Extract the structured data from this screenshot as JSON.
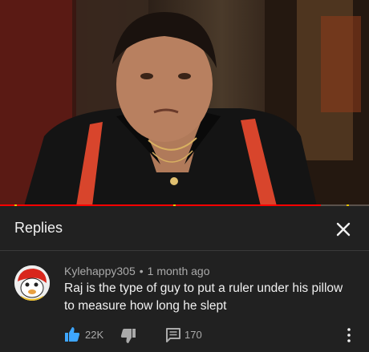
{
  "video": {
    "progress_fraction": 0.87,
    "chapter_marks_fraction": [
      0.04,
      0.47,
      0.94
    ]
  },
  "panel": {
    "title": "Replies",
    "close_icon": "close-icon"
  },
  "comment": {
    "author": "Kylehappy305",
    "separator": "•",
    "timestamp": "1 month ago",
    "text": "Raj is the type of guy to put a ruler under his pillow to measure how long he slept",
    "like_count": "22K",
    "reply_count": "170",
    "icons": {
      "avatar": "avatar",
      "like": "thumbs-up-icon",
      "dislike": "thumbs-down-icon",
      "reply": "comment-icon",
      "more": "more-vert-icon"
    }
  },
  "colors": {
    "background": "#212121",
    "text_primary": "#f1f1f1",
    "text_secondary": "#aaaaaa",
    "like_active": "#3ea6ff",
    "progress": "#ff0000"
  }
}
